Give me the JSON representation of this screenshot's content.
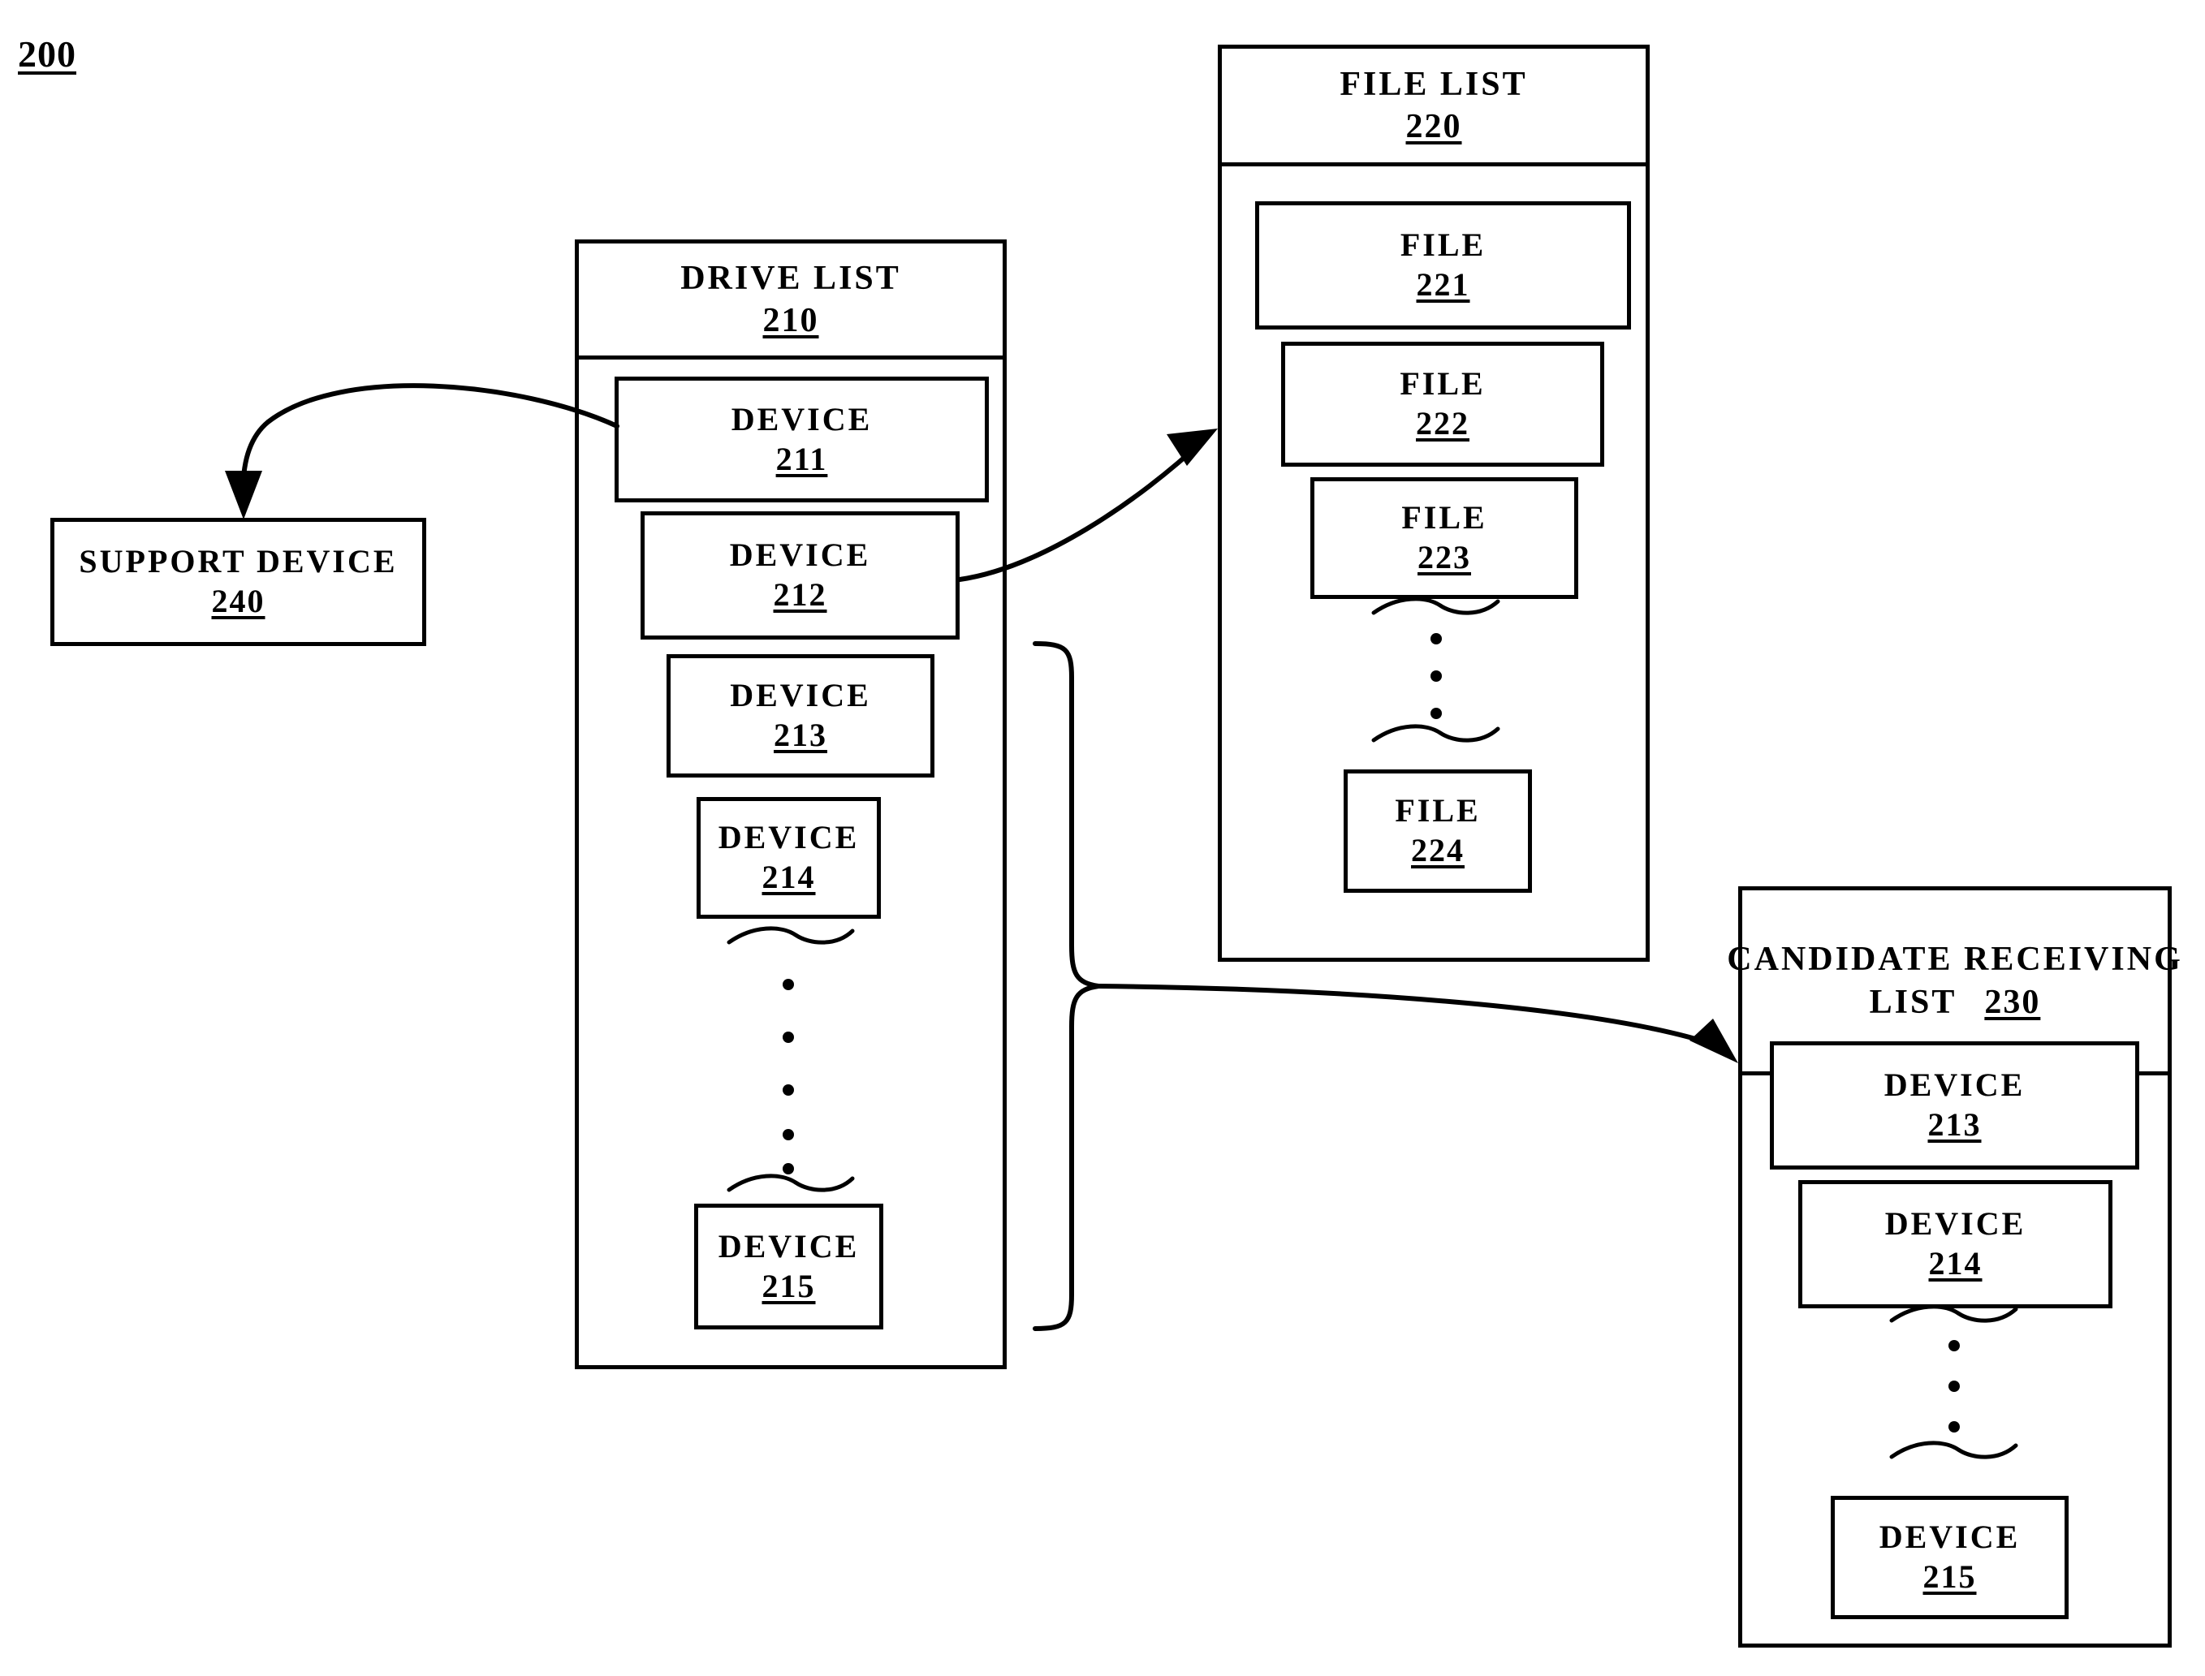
{
  "figure": {
    "number": "200"
  },
  "drive_list": {
    "title": "DRIVE LIST",
    "ref": "210",
    "items": [
      {
        "label": "DEVICE",
        "ref": "211"
      },
      {
        "label": "DEVICE",
        "ref": "212"
      },
      {
        "label": "DEVICE",
        "ref": "213"
      },
      {
        "label": "DEVICE",
        "ref": "214"
      },
      {
        "label": "DEVICE",
        "ref": "215"
      }
    ],
    "ellipsis_dots": 5
  },
  "file_list": {
    "title": "FILE LIST",
    "ref": "220",
    "items": [
      {
        "label": "FILE",
        "ref": "221"
      },
      {
        "label": "FILE",
        "ref": "222"
      },
      {
        "label": "FILE",
        "ref": "223"
      },
      {
        "label": "FILE",
        "ref": "224"
      }
    ],
    "ellipsis_dots": 3
  },
  "candidate_receiving_list": {
    "title_line1": "CANDIDATE RECEIVING",
    "title_line2": "LIST",
    "ref": "230",
    "items": [
      {
        "label": "DEVICE",
        "ref": "213"
      },
      {
        "label": "DEVICE",
        "ref": "214"
      },
      {
        "label": "DEVICE",
        "ref": "215"
      }
    ],
    "ellipsis_dots": 3
  },
  "support_device": {
    "label": "SUPPORT DEVICE",
    "ref": "240"
  },
  "connectors": [
    {
      "name": "device-211-to-support-device",
      "from": "DEVICE 211",
      "to": "SUPPORT DEVICE 240"
    },
    {
      "name": "device-212-to-file-list",
      "from": "DEVICE 212",
      "to": "FILE LIST 220"
    },
    {
      "name": "device-group-to-candidate-receiving-list",
      "from": "DEVICE 213-215 brace",
      "to": "CANDIDATE RECEIVING LIST 230"
    }
  ],
  "colors": {
    "ink": "#000000",
    "paper": "#ffffff"
  }
}
